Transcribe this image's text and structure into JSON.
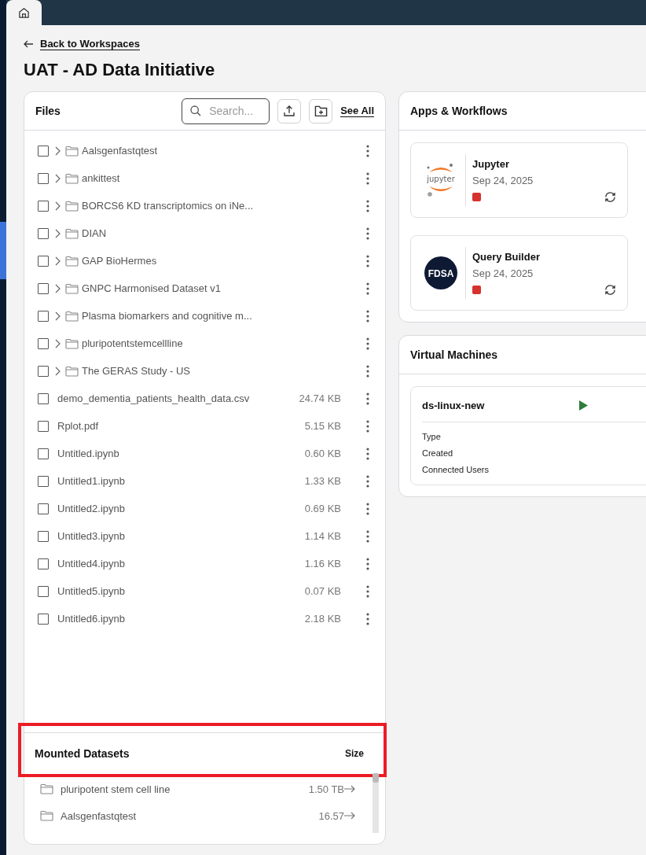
{
  "back_link": "Back to Workspaces",
  "title": "UAT - AD Data Initiative",
  "files": {
    "title": "Files",
    "search": {
      "placeholder": "Search..."
    },
    "see_all": "See All",
    "rows": [
      {
        "kind": "folder",
        "name": "Aalsgenfastqtest",
        "checked": false
      },
      {
        "kind": "folder",
        "name": "ankittest",
        "checked": false
      },
      {
        "kind": "folder",
        "name": "BORCS6 KD transcriptomics on iNe...",
        "checked": false
      },
      {
        "kind": "folder",
        "name": "DIAN",
        "checked": false
      },
      {
        "kind": "folder",
        "name": "GAP BioHermes",
        "checked": false
      },
      {
        "kind": "folder",
        "name": "GNPC Harmonised Dataset v1",
        "checked": false
      },
      {
        "kind": "folder",
        "name": "Plasma biomarkers and cognitive m...",
        "checked": false
      },
      {
        "kind": "folder",
        "name": "pluripotentstemcellline",
        "checked": false
      },
      {
        "kind": "folder",
        "name": "The GERAS Study - US",
        "checked": false
      },
      {
        "kind": "file",
        "name": "demo_dementia_patients_health_data.csv",
        "size": "24.74 KB",
        "checked": false
      },
      {
        "kind": "file",
        "name": "Rplot.pdf",
        "size": "5.15 KB",
        "checked": false
      },
      {
        "kind": "file",
        "name": "Untitled.ipynb",
        "size": "0.60 KB",
        "checked": false
      },
      {
        "kind": "file",
        "name": "Untitled1.ipynb",
        "size": "1.33 KB",
        "checked": false
      },
      {
        "kind": "file",
        "name": "Untitled2.ipynb",
        "size": "0.69 KB",
        "checked": false
      },
      {
        "kind": "file",
        "name": "Untitled3.ipynb",
        "size": "1.14 KB",
        "checked": false
      },
      {
        "kind": "file",
        "name": "Untitled4.ipynb",
        "size": "1.16 KB",
        "checked": false
      },
      {
        "kind": "file",
        "name": "Untitled5.ipynb",
        "size": "0.07 KB",
        "checked": false
      },
      {
        "kind": "file",
        "name": "Untitled6.ipynb",
        "size": "2.18 KB",
        "checked": false
      }
    ]
  },
  "mounted_datasets": {
    "title": "Mounted Datasets",
    "size_header": "Size",
    "highlighted": true,
    "rows": [
      {
        "name": "pluripotent stem cell line",
        "size": "1.50 TB"
      },
      {
        "name": "Aalsgenfastqtest",
        "size": "16.57"
      }
    ]
  },
  "apps": {
    "title": "Apps & Workflows",
    "items": [
      {
        "kind": "jupyter",
        "logo_text": "jupyter",
        "name": "Jupyter",
        "date": "Sep 24, 2025",
        "running": false
      },
      {
        "kind": "fdsa",
        "logo_text": "FDSA",
        "name": "Query Builder",
        "date": "Sep 24, 2025",
        "running": false
      }
    ]
  },
  "virtual_machines": {
    "title": "Virtual Machines",
    "items": [
      {
        "name": "ds-linux-new",
        "running": false,
        "fields": [
          "Type",
          "Created",
          "Connected Users"
        ]
      }
    ]
  }
}
